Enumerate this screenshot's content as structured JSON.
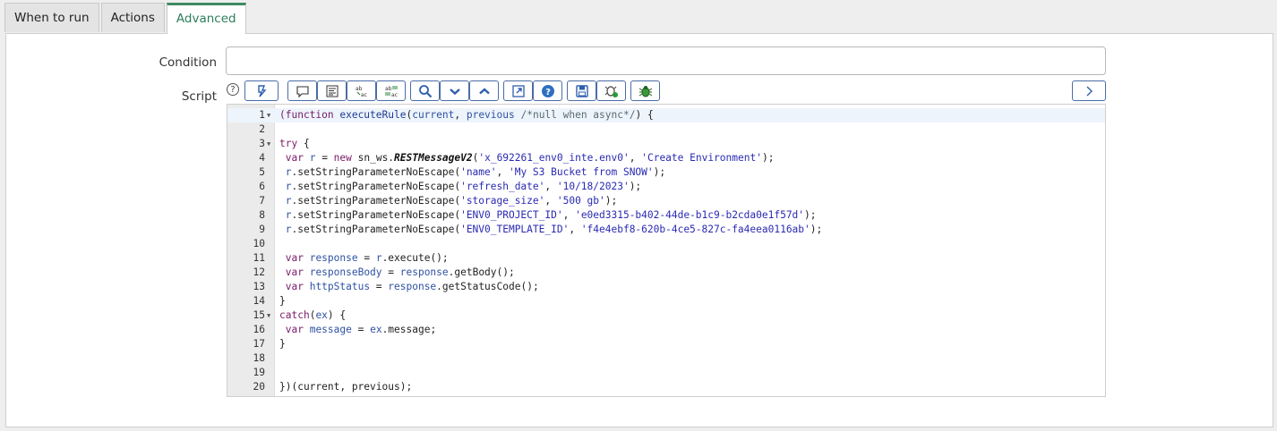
{
  "tabs": [
    {
      "label": "When to run",
      "active": false
    },
    {
      "label": "Actions",
      "active": false
    },
    {
      "label": "Advanced",
      "active": true
    }
  ],
  "form": {
    "condition_label": "Condition",
    "condition_value": "",
    "script_label": "Script",
    "help_glyph": "?"
  },
  "toolbar": {
    "buttons": [
      {
        "name": "toggle-syntax-button",
        "icon": "syntax-toggle-icon"
      },
      {
        "name": "comment-button",
        "icon": "comment-icon"
      },
      {
        "name": "format-code-button",
        "icon": "format-code-icon"
      },
      {
        "name": "replace-button",
        "icon": "replace-icon"
      },
      {
        "name": "replace-all-button",
        "icon": "replace-all-icon"
      },
      {
        "name": "search-button",
        "icon": "search-icon"
      },
      {
        "name": "next-button",
        "icon": "chevron-down-icon"
      },
      {
        "name": "previous-button",
        "icon": "chevron-up-icon"
      },
      {
        "name": "fullscreen-button",
        "icon": "expand-icon"
      },
      {
        "name": "help-button",
        "icon": "help-icon"
      },
      {
        "name": "save-button",
        "icon": "save-icon"
      },
      {
        "name": "script-debugger-button",
        "icon": "debug-icon"
      },
      {
        "name": "script-tracer-button",
        "icon": "bug-icon"
      },
      {
        "name": "collapse-toolbar-button",
        "icon": "chevron-right-icon"
      }
    ]
  },
  "editor": {
    "active_line": 1,
    "lines": [
      {
        "n": "1",
        "fold": true,
        "tokens": [
          [
            "kw",
            "(function "
          ],
          [
            "fn",
            "executeRule"
          ],
          [
            "p",
            "("
          ],
          [
            "var",
            "current"
          ],
          [
            "p",
            ", "
          ],
          [
            "var",
            "previous"
          ],
          [
            "p",
            " "
          ],
          [
            "cm",
            "/*null when async*/"
          ],
          [
            "p",
            ") {"
          ]
        ]
      },
      {
        "n": "2",
        "fold": false,
        "tokens": []
      },
      {
        "n": "3",
        "fold": true,
        "tokens": [
          [
            "kw",
            "try"
          ],
          [
            "p",
            " {"
          ]
        ]
      },
      {
        "n": "4",
        "fold": false,
        "tokens": [
          [
            "kw",
            " var"
          ],
          [
            "p",
            " "
          ],
          [
            "var",
            "r"
          ],
          [
            "p",
            " = "
          ],
          [
            "kw",
            "new"
          ],
          [
            "p",
            " sn_ws."
          ],
          [
            "cls",
            "RESTMessageV2"
          ],
          [
            "p",
            "("
          ],
          [
            "str",
            "'x_692261_env0_inte.env0'"
          ],
          [
            "p",
            ", "
          ],
          [
            "str",
            "'Create Environment'"
          ],
          [
            "p",
            ");"
          ]
        ]
      },
      {
        "n": "5",
        "fold": false,
        "tokens": [
          [
            "var",
            " r"
          ],
          [
            "p",
            ".setStringParameterNoEscape("
          ],
          [
            "str",
            "'name'"
          ],
          [
            "p",
            ", "
          ],
          [
            "str",
            "'My S3 Bucket from SNOW'"
          ],
          [
            "p",
            ");"
          ]
        ]
      },
      {
        "n": "6",
        "fold": false,
        "tokens": [
          [
            "var",
            " r"
          ],
          [
            "p",
            ".setStringParameterNoEscape("
          ],
          [
            "str",
            "'refresh_date'"
          ],
          [
            "p",
            ", "
          ],
          [
            "str",
            "'10/18/2023'"
          ],
          [
            "p",
            ");"
          ]
        ]
      },
      {
        "n": "7",
        "fold": false,
        "tokens": [
          [
            "var",
            " r"
          ],
          [
            "p",
            ".setStringParameterNoEscape("
          ],
          [
            "str",
            "'storage_size'"
          ],
          [
            "p",
            ", "
          ],
          [
            "str",
            "'500 gb'"
          ],
          [
            "p",
            ");"
          ]
        ]
      },
      {
        "n": "8",
        "fold": false,
        "tokens": [
          [
            "var",
            " r"
          ],
          [
            "p",
            ".setStringParameterNoEscape("
          ],
          [
            "str",
            "'ENV0_PROJECT_ID'"
          ],
          [
            "p",
            ", "
          ],
          [
            "str",
            "'e0ed3315-b402-44de-b1c9-b2cda0e1f57d'"
          ],
          [
            "p",
            ");"
          ]
        ]
      },
      {
        "n": "9",
        "fold": false,
        "tokens": [
          [
            "var",
            " r"
          ],
          [
            "p",
            ".setStringParameterNoEscape("
          ],
          [
            "str",
            "'ENV0_TEMPLATE_ID'"
          ],
          [
            "p",
            ", "
          ],
          [
            "str",
            "'f4e4ebf8-620b-4ce5-827c-fa4eea0116ab'"
          ],
          [
            "p",
            ");"
          ]
        ]
      },
      {
        "n": "10",
        "fold": false,
        "tokens": []
      },
      {
        "n": "11",
        "fold": false,
        "tokens": [
          [
            "kw",
            " var"
          ],
          [
            "p",
            " "
          ],
          [
            "var",
            "response"
          ],
          [
            "p",
            " = "
          ],
          [
            "var",
            "r"
          ],
          [
            "p",
            ".execute();"
          ]
        ]
      },
      {
        "n": "12",
        "fold": false,
        "tokens": [
          [
            "kw",
            " var"
          ],
          [
            "p",
            " "
          ],
          [
            "var",
            "responseBody"
          ],
          [
            "p",
            " = "
          ],
          [
            "var",
            "response"
          ],
          [
            "p",
            ".getBody();"
          ]
        ]
      },
      {
        "n": "13",
        "fold": false,
        "tokens": [
          [
            "kw",
            " var"
          ],
          [
            "p",
            " "
          ],
          [
            "var",
            "httpStatus"
          ],
          [
            "p",
            " = "
          ],
          [
            "var",
            "response"
          ],
          [
            "p",
            ".getStatusCode();"
          ]
        ]
      },
      {
        "n": "14",
        "fold": false,
        "tokens": [
          [
            "p",
            "}"
          ]
        ]
      },
      {
        "n": "15",
        "fold": true,
        "tokens": [
          [
            "kw",
            "catch"
          ],
          [
            "p",
            "("
          ],
          [
            "var",
            "ex"
          ],
          [
            "p",
            ") {"
          ]
        ]
      },
      {
        "n": "16",
        "fold": false,
        "tokens": [
          [
            "kw",
            " var"
          ],
          [
            "p",
            " "
          ],
          [
            "var",
            "message"
          ],
          [
            "p",
            " = "
          ],
          [
            "var",
            "ex"
          ],
          [
            "p",
            ".message;"
          ]
        ]
      },
      {
        "n": "17",
        "fold": false,
        "tokens": [
          [
            "p",
            "}"
          ]
        ]
      },
      {
        "n": "18",
        "fold": false,
        "tokens": []
      },
      {
        "n": "19",
        "fold": false,
        "tokens": []
      },
      {
        "n": "20",
        "fold": false,
        "tokens": [
          [
            "p",
            "})(current, previous);"
          ]
        ]
      }
    ]
  }
}
